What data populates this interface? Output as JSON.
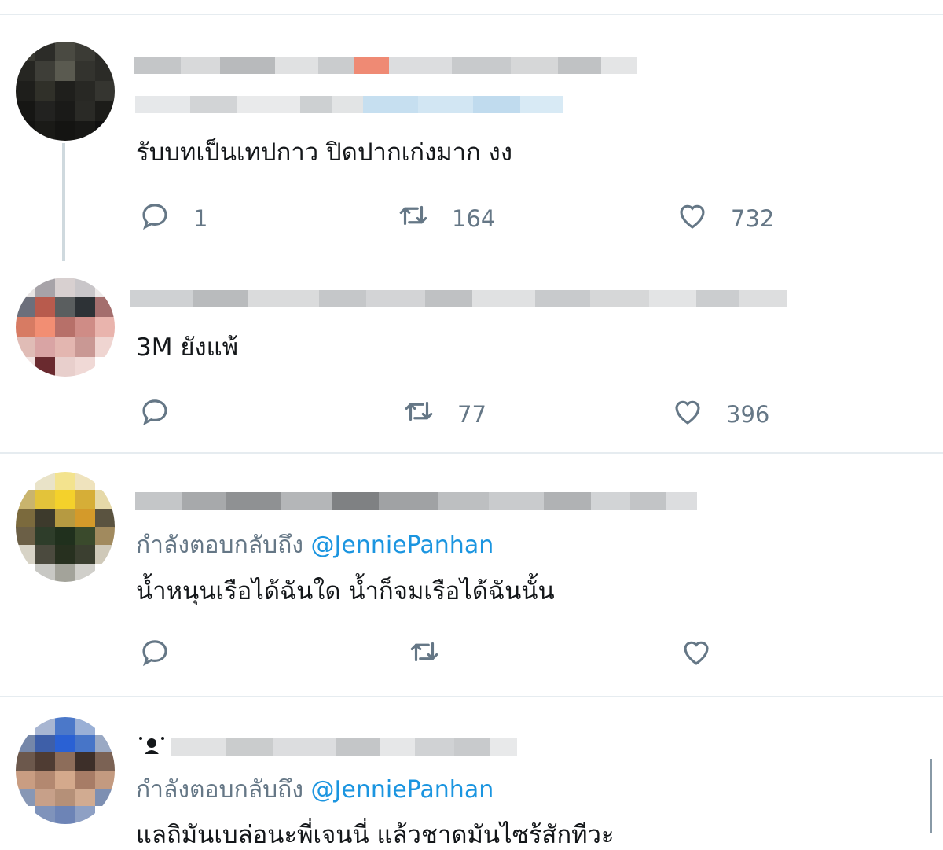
{
  "tweets": [
    {
      "text": "รับบทเป็นเทปกาว ปิดปากเก่งมาก งง",
      "actions": {
        "reply": "1",
        "retweet": "164",
        "like": "732"
      }
    },
    {
      "text": "3M ยังแพ้",
      "actions": {
        "reply": "",
        "retweet": "77",
        "like": "396"
      }
    },
    {
      "replying_to_label": "กำลังตอบกลับถึง",
      "replying_to_handle": "@JenniePanhan",
      "text": "น้ำหนุนเรือได้ฉันใด น้ำก็จมเรือได้ฉันนั้น",
      "actions": {
        "reply": "",
        "retweet": "",
        "like": ""
      }
    },
    {
      "replying_to_label": "กำลังตอบกลับถึง",
      "replying_to_handle": "@JenniePanhan",
      "text": "แลถิมันเบล่อนะพี่เจนนี่ แล้วชาดมันไซร้สักทีวะ"
    }
  ],
  "colors": {
    "text": "#14171a",
    "muted": "#657786",
    "link": "#1b95e0",
    "divider": "#e6ecf0"
  },
  "icons": [
    "reply-icon",
    "retweet-icon",
    "like-icon"
  ]
}
